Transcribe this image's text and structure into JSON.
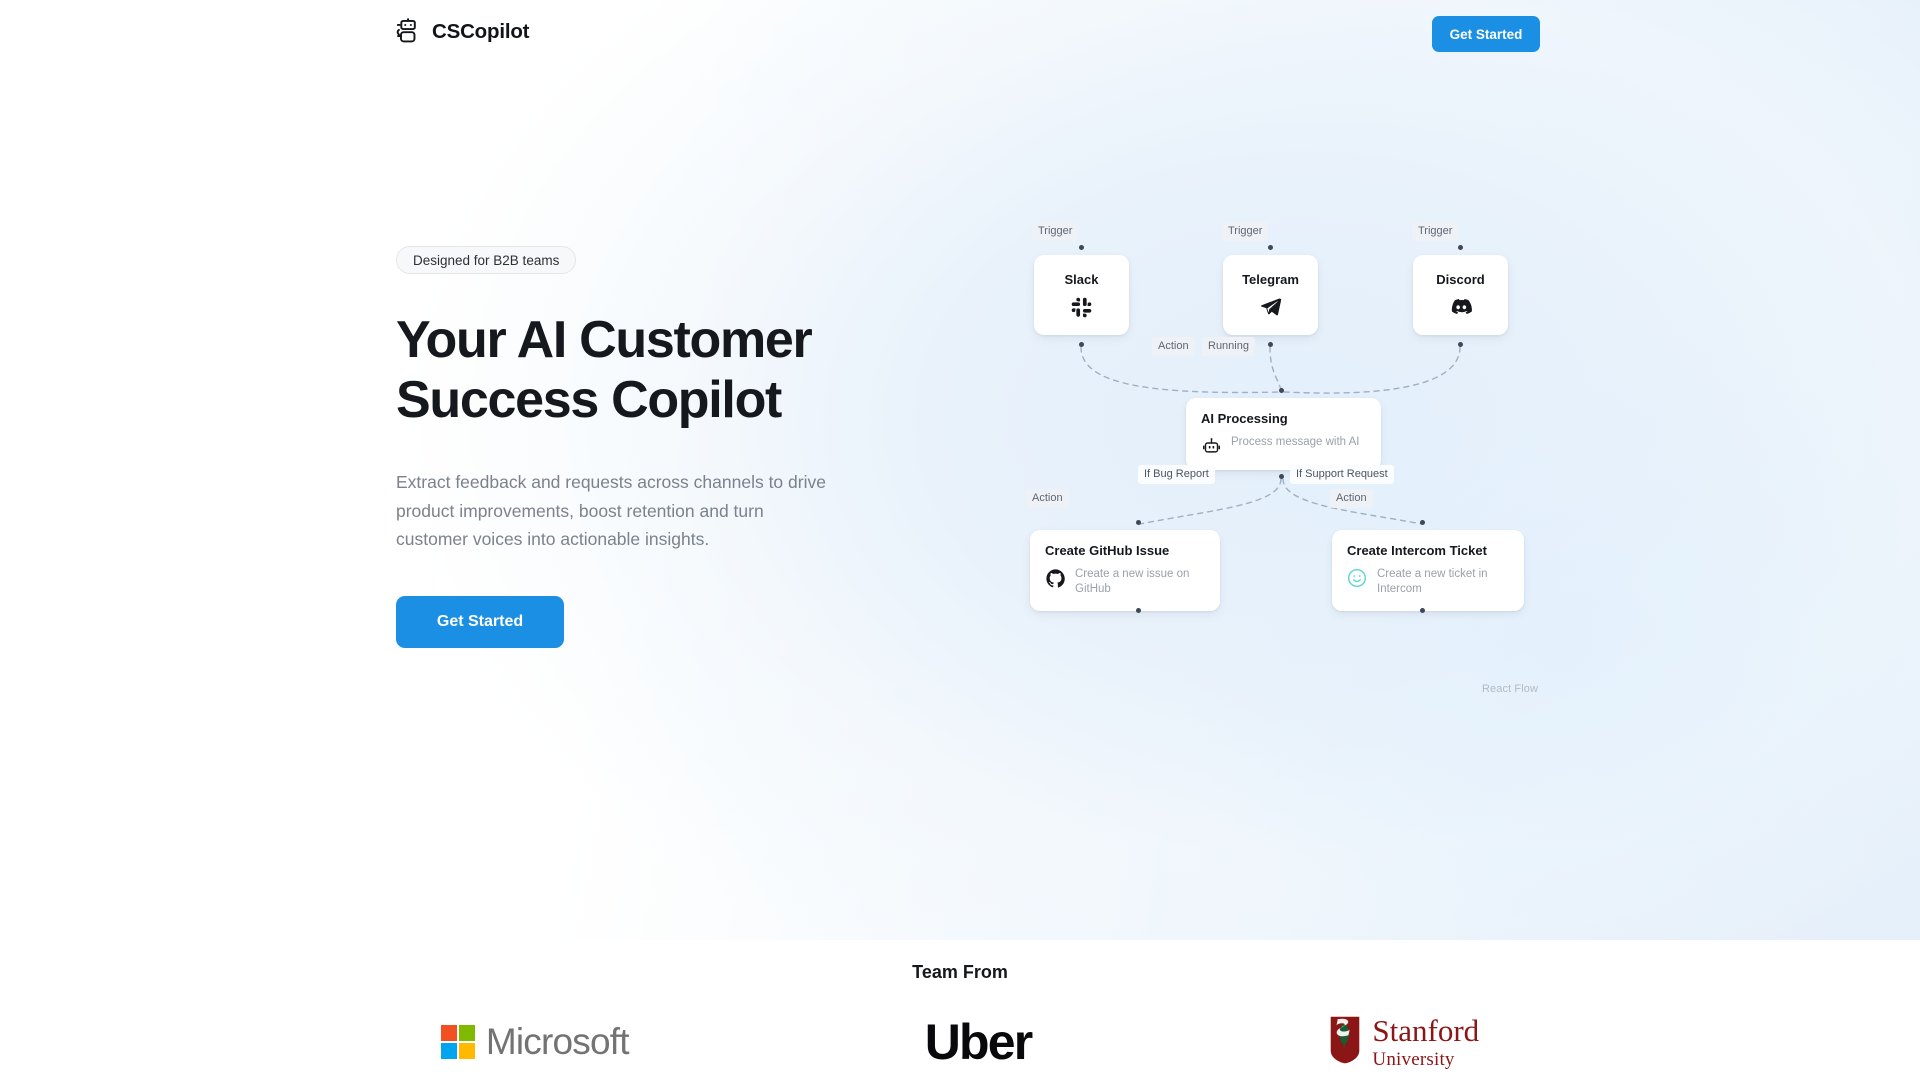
{
  "header": {
    "brand_name": "CSCopilot",
    "brand_icon": "bot-icon",
    "cta_label": "Get Started"
  },
  "hero": {
    "badge": "Designed for B2B teams",
    "headline_line1": "Your AI Customer",
    "headline_line2": "Success Copilot",
    "subcopy": "Extract feedback and requests across channels to drive product improvements, boost retention and turn customer voices into actionable insights.",
    "cta_label": "Get Started"
  },
  "flow": {
    "attribution": "React Flow",
    "nodes": [
      {
        "id": "slack",
        "tag": "Trigger",
        "title": "Slack",
        "icon": "slack-icon"
      },
      {
        "id": "telegram",
        "tag": "Trigger",
        "title": "Telegram",
        "icon": "telegram-icon"
      },
      {
        "id": "discord",
        "tag": "Trigger",
        "title": "Discord",
        "icon": "discord-icon"
      },
      {
        "id": "ai",
        "tag": "Action",
        "status": "Running",
        "title": "AI Processing",
        "desc": "Process message with AI",
        "icon": "bot-icon"
      },
      {
        "id": "github",
        "tag": "Action",
        "title": "Create GitHub Issue",
        "desc": "Create a new issue on GitHub",
        "icon": "github-icon"
      },
      {
        "id": "intercom",
        "tag": "Action",
        "title": "Create Intercom Ticket",
        "desc": "Create a new ticket in Intercom",
        "icon": "intercom-icon"
      }
    ],
    "edge_labels": {
      "bug": "If Bug Report",
      "support": "If Support Request"
    }
  },
  "team": {
    "title": "Team From",
    "logos": [
      {
        "name": "Microsoft",
        "text": "Microsoft"
      },
      {
        "name": "Uber",
        "text": "Uber"
      },
      {
        "name": "Stanford University",
        "line1": "Stanford",
        "line2": "University"
      }
    ]
  },
  "colors": {
    "accent": "#1a8fe3",
    "headline": "#15181c",
    "muted": "#7b828c",
    "canvas": "#e9f2fb",
    "stanford_red": "#8c1515",
    "intercom_teal": "#5bd4d4"
  }
}
